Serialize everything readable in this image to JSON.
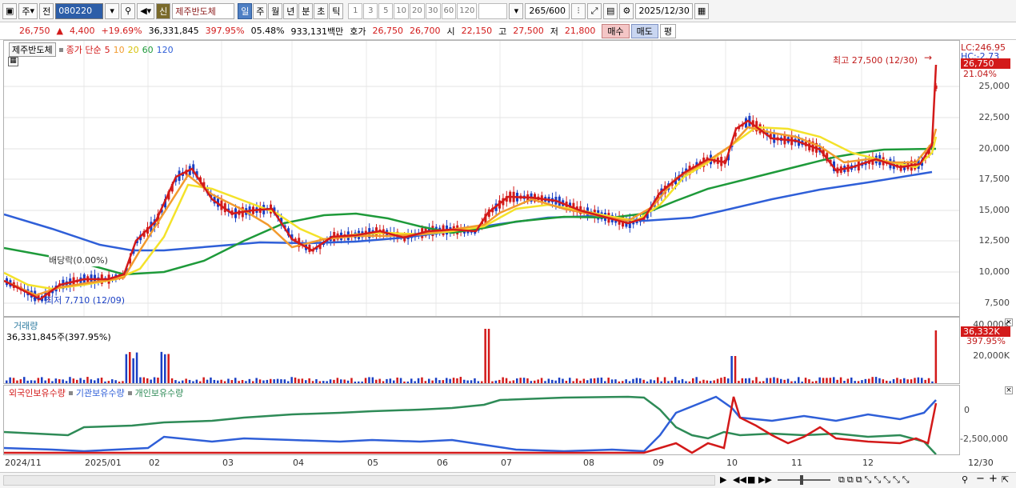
{
  "toolbar": {
    "market": "주",
    "prefix": "전",
    "code": "080220",
    "new_label": "신",
    "stock_name": "제주반도체",
    "periods": [
      "일",
      "주",
      "월",
      "년",
      "분",
      "초",
      "틱"
    ],
    "active_period": "일",
    "numbers": [
      "1",
      "3",
      "5",
      "10",
      "20",
      "30",
      "60",
      "120"
    ],
    "count": "265",
    "count_total": "/600",
    "date": "2025/12/30"
  },
  "quote": {
    "price": "26,750",
    "arrow": "▲",
    "change": "4,400",
    "change_pct": "+19.69%",
    "volume": "36,331,845",
    "volume_ratio": "397.95%",
    "turnover": "05.48%",
    "amount": "933,131백만",
    "hoga_label": "호가",
    "ask": "26,750",
    "bid": "26,700",
    "open_label": "시",
    "open": "22,150",
    "high_label": "고",
    "high": "27,500",
    "low_label": "저",
    "low": "21,800",
    "buy": "매수",
    "sell": "매도",
    "even": "평"
  },
  "price_panel": {
    "stock_label": "제주반도체",
    "ma_label": "종가 단순",
    "ma_periods": [
      "5",
      "10",
      "20",
      "60",
      "120"
    ],
    "ma_colors": [
      "#d31a1a",
      "#f29a2e",
      "#f4e22a",
      "#1e9a3a",
      "#2f5fd8"
    ],
    "lc": "LC:246.95",
    "hc": "HC:-2.73",
    "price_tag": "26,750",
    "pct_tag": "21.04%",
    "high_note": "최고 27,500 (12/30)",
    "low_note": "최저 7,710 (12/09)",
    "dividend_note": "배당락(0.00%)",
    "y_ticks": [
      "25,000",
      "22,500",
      "20,000",
      "17,500",
      "15,000",
      "12,500",
      "10,000",
      "7,500"
    ]
  },
  "volume_panel": {
    "label": "거래량",
    "value": "36,331,845주(397.95%)",
    "y_top": "40,000K",
    "vol_tag": "36,332K",
    "pct_tag": "397.95%",
    "y_mid": "20,000K"
  },
  "holding_panel": {
    "legend": [
      "외국인보유수량",
      "기관보유수량",
      "개인보유수량"
    ],
    "colors": [
      "#d31a1a",
      "#2f5fd8",
      "#2e8b57"
    ],
    "y_ticks": [
      "0",
      "-2,500,000"
    ]
  },
  "x_axis": [
    "2024/11",
    "2025/01",
    "02",
    "03",
    "04",
    "05",
    "06",
    "07",
    "08",
    "09",
    "10",
    "11",
    "12"
  ],
  "x_end": "12/30",
  "chart_data": {
    "type": "line",
    "title": "제주반도체",
    "price_series_approx": [
      {
        "date": "2024/11",
        "close": 9300
      },
      {
        "date": "2024/12/09",
        "close": 7710
      },
      {
        "date": "2025/01",
        "close": 9600
      },
      {
        "date": "2025/02",
        "close": 13800
      },
      {
        "date": "2025/02 mid",
        "close": 19500
      },
      {
        "date": "2025/03",
        "close": 15200
      },
      {
        "date": "2025/04",
        "close": 11600
      },
      {
        "date": "2025/05",
        "close": 12600
      },
      {
        "date": "2025/06",
        "close": 13200
      },
      {
        "date": "2025/06 late",
        "close": 17200
      },
      {
        "date": "2025/07",
        "close": 15800
      },
      {
        "date": "2025/08",
        "close": 14200
      },
      {
        "date": "2025/09",
        "close": 15600
      },
      {
        "date": "2025/09 late",
        "close": 18800
      },
      {
        "date": "2025/10",
        "close": 24500
      },
      {
        "date": "2025/10 mid",
        "close": 21000
      },
      {
        "date": "2025/11",
        "close": 20000
      },
      {
        "date": "2025/11 late",
        "close": 18000
      },
      {
        "date": "2025/12",
        "close": 18600
      },
      {
        "date": "2025/12/30",
        "close": 26750
      }
    ],
    "ylim": [
      7000,
      27500
    ]
  }
}
